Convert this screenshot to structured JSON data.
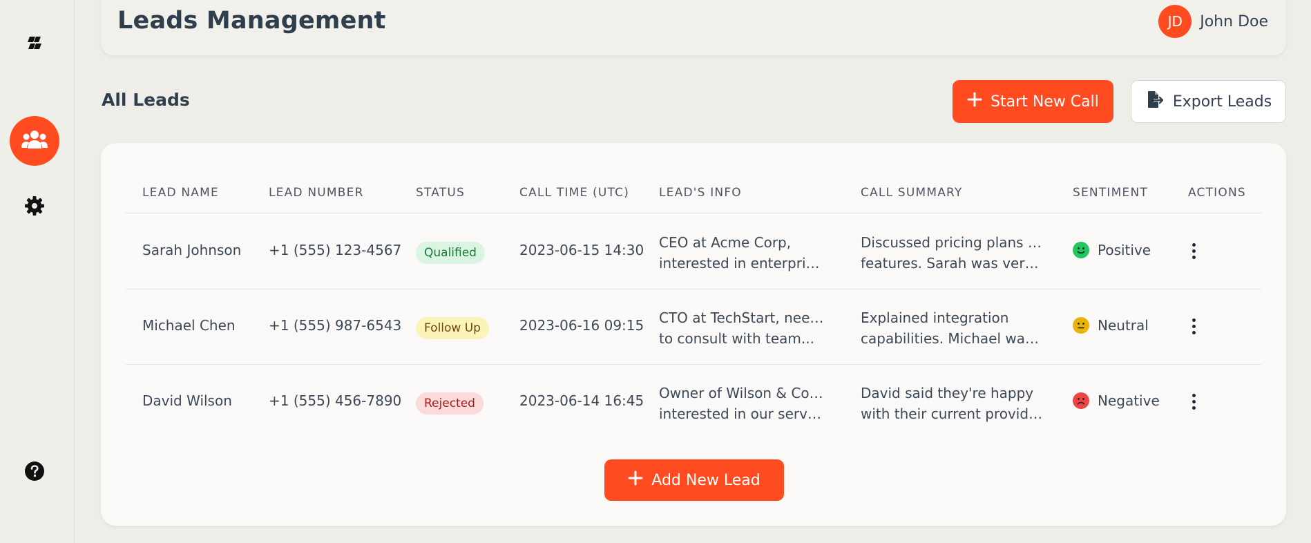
{
  "header": {
    "title": "Leads Management",
    "user": {
      "initials": "JD",
      "name": "John Doe"
    }
  },
  "sidebar": {
    "items": [
      {
        "icon": "logo-icon",
        "active": false
      },
      {
        "icon": "users-icon",
        "active": true
      },
      {
        "icon": "gear-icon",
        "active": false
      },
      {
        "icon": "help-icon",
        "active": false
      }
    ]
  },
  "section": {
    "title": "All Leads",
    "start_call_label": "Start New Call",
    "export_label": "Export Leads"
  },
  "table": {
    "columns": [
      "LEAD NAME",
      "LEAD NUMBER",
      "STATUS",
      "CALL TIME (UTC)",
      "LEAD'S INFO",
      "CALL SUMMARY",
      "SENTIMENT",
      "ACTIONS"
    ],
    "rows": [
      {
        "name": "Sarah Johnson",
        "number": "+1 (555) 123-4567",
        "status": "Qualified",
        "call_time": "2023-06-15 14:30",
        "info_line1": "CEO at Acme Corp,",
        "info_line2": "interested in enterprise...",
        "summary_line1": "Discussed pricing plans and",
        "summary_line2": "features. Sarah was very...",
        "sentiment": "Positive"
      },
      {
        "name": "Michael Chen",
        "number": "+1 (555) 987-6543",
        "status": "Follow Up",
        "call_time": "2023-06-16 09:15",
        "info_line1": "CTO at TechStart, needs",
        "info_line2": "to consult with team...",
        "summary_line1": "Explained integration",
        "summary_line2": "capabilities. Michael wants...",
        "sentiment": "Neutral"
      },
      {
        "name": "David Wilson",
        "number": "+1 (555) 456-7890",
        "status": "Rejected",
        "call_time": "2023-06-14 16:45",
        "info_line1": "Owner of Wilson & Co, not",
        "info_line2": "interested in our service",
        "summary_line1": "David said they're happy",
        "summary_line2": "with their current provider...",
        "sentiment": "Negative"
      }
    ],
    "add_lead_label": "Add New Lead"
  },
  "colors": {
    "accent": "#ff4b1f",
    "positive": "#22c55e",
    "neutral": "#eab308",
    "negative": "#ef4444"
  }
}
